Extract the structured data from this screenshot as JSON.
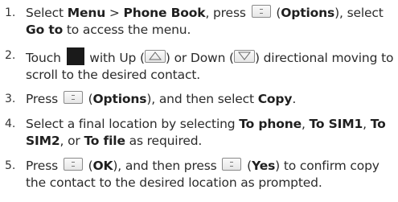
{
  "steps": [
    {
      "n": "1.",
      "p": [
        "Select ",
        "Menu",
        " > ",
        "Phone Book",
        ", press ",
        " (",
        "Options",
        "), select ",
        "Go to",
        " to access the menu."
      ]
    },
    {
      "n": "2.",
      "p": [
        "Touch ",
        " with Up (",
        ") or Down (",
        ") directional moving to scroll to the desired contact."
      ]
    },
    {
      "n": "3.",
      "p": [
        "Press ",
        " (",
        "Options",
        "), and then select ",
        "Copy",
        "."
      ]
    },
    {
      "n": "4.",
      "p": [
        "Select a final location by selecting ",
        "To phone",
        ", ",
        "To SIM1",
        ", ",
        "To SIM2",
        ", or ",
        "To file",
        " as required."
      ]
    },
    {
      "n": "5.",
      "p": [
        "Press ",
        " (",
        "OK",
        "), and then press ",
        " (",
        "Yes",
        ") to confirm copy the contact to the desired location as prompted."
      ]
    }
  ],
  "icons": {
    "soft_key": "options-key-icon",
    "nav_pad": "black-navigation-key-icon",
    "up": "up-arrow-key-icon",
    "down": "down-arrow-key-icon"
  }
}
